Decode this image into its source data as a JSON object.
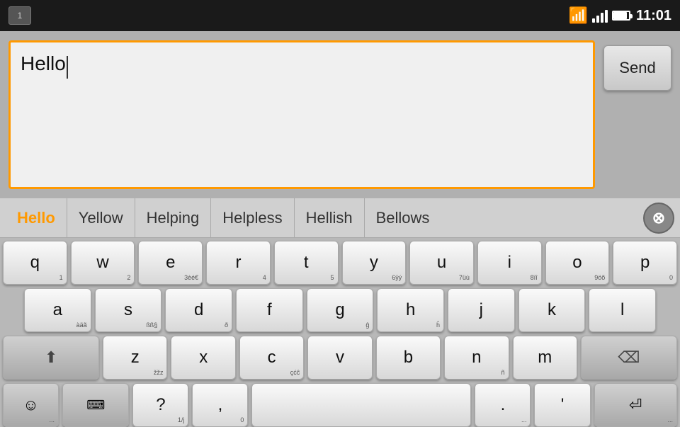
{
  "statusBar": {
    "notificationNum": "1",
    "time": "11:01"
  },
  "mainArea": {
    "inputText": "Hello",
    "sendLabel": "Send"
  },
  "suggestions": {
    "items": [
      {
        "id": "hello",
        "label": "Hello",
        "active": true
      },
      {
        "id": "yellow",
        "label": "Yellow",
        "active": false
      },
      {
        "id": "helping",
        "label": "Helping",
        "active": false
      },
      {
        "id": "helpless",
        "label": "Helpless",
        "active": false
      },
      {
        "id": "hellish",
        "label": "Hellish",
        "active": false
      },
      {
        "id": "bellows",
        "label": "Bellows",
        "active": false
      }
    ]
  },
  "keyboard": {
    "rows": [
      [
        "q",
        "w",
        "e",
        "r",
        "t",
        "y",
        "u",
        "i",
        "o",
        "p"
      ],
      [
        "a",
        "s",
        "d",
        "f",
        "g",
        "h",
        "j",
        "k",
        "l"
      ],
      [
        "z",
        "x",
        "c",
        "v",
        "b",
        "n",
        "m"
      ]
    ],
    "subs": {
      "q": "1",
      "w": "2",
      "e": "3èé€",
      "r": "4",
      "t": "5",
      "y": "6ÿý",
      "u": "7üù",
      "i": "8ïî",
      "o": "9öõ",
      "p": "0",
      "a": "àäã",
      "s": "ßß§",
      "d": "ð",
      "g": "ĝ",
      "h": "ĥ",
      "j": "",
      "k": "",
      "l": "",
      "z": "žžz",
      "x": "",
      "c": "çćĉ",
      "v": "",
      "b": "",
      "n": "ñ",
      "m": ""
    }
  }
}
